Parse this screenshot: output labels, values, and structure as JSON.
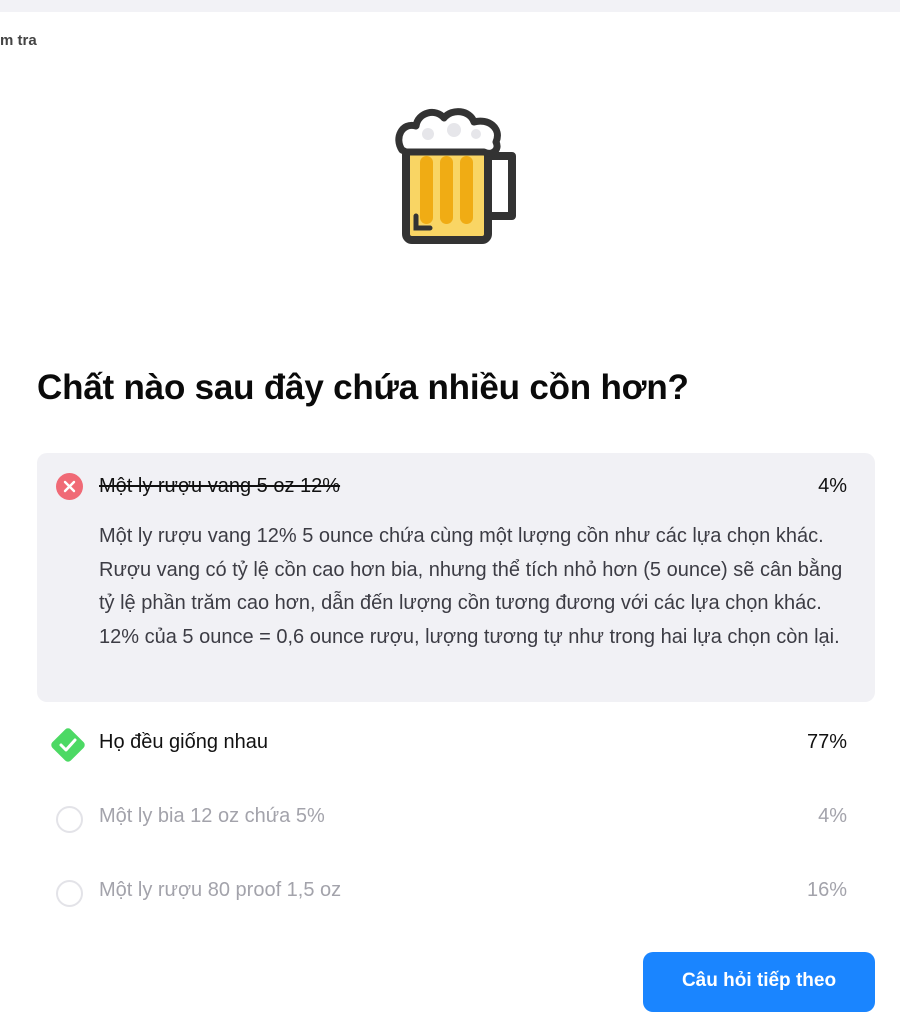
{
  "breadcrumb": "m tra",
  "hero": {
    "icon": "beer-mug-icon"
  },
  "question": "Chất nào sau đây chứa nhiều cồn hơn?",
  "answers": [
    {
      "label": "Một ly rượu vang 5 oz 12%",
      "percent": "4%",
      "state": "incorrect-selected",
      "explanation": "Một ly rượu vang 12% 5 ounce chứa cùng một lượng cồn như các lựa chọn khác. Rượu vang có tỷ lệ cồn cao hơn bia, nhưng thể tích nhỏ hơn (5 ounce) sẽ cân bằng tỷ lệ phần trăm cao hơn, dẫn đến lượng cồn tương đương với các lựa chọn khác. 12% của 5 ounce = 0,6 ounce rượu, lượng tương tự như trong hai lựa chọn còn lại."
    },
    {
      "label": "Họ đều giống nhau",
      "percent": "77%",
      "state": "correct"
    },
    {
      "label": "Một ly bia 12 oz chứa 5%",
      "percent": "4%",
      "state": "neutral"
    },
    {
      "label": "Một ly rượu 80 proof 1,5 oz",
      "percent": "16%",
      "state": "neutral"
    }
  ],
  "next_button": "Câu hỏi tiếp theo",
  "colors": {
    "accent": "#1a85ff",
    "incorrect": "#f06a76",
    "correct": "#4cd964",
    "panel": "#f1f1f5"
  }
}
